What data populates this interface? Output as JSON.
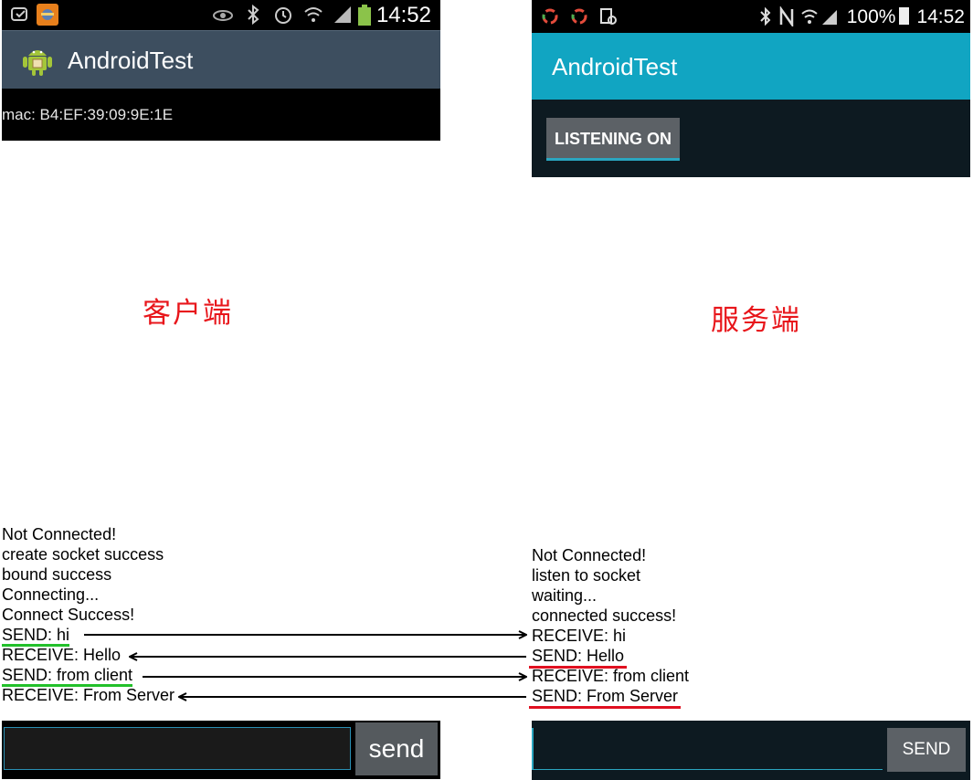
{
  "client": {
    "status_bar": {
      "time": "14:52",
      "icons": [
        "message-icon",
        "notification-app-icon",
        "eye-icon",
        "bluetooth-icon",
        "alarm-icon",
        "wifi-icon",
        "signal-icon",
        "battery-icon"
      ]
    },
    "app_title": "AndroidTest",
    "mac_text": "mac: B4:EF:39:09:9E:1E",
    "label": "客户端",
    "log": [
      "Not Connected!",
      "create socket success",
      "bound success",
      "Connecting...",
      "Connect Success!",
      "SEND: hi",
      "RECEIVE: Hello",
      "SEND: from client",
      "RECEIVE: From Server"
    ],
    "input_value": "",
    "send_label": "send"
  },
  "server": {
    "status_bar": {
      "time": "14:52",
      "battery": "100%",
      "icons": [
        "sync-icon",
        "sync-icon",
        "screenshot-icon",
        "bluetooth-icon",
        "nfc-icon",
        "wifi-icon",
        "signal-icon",
        "battery-icon"
      ]
    },
    "app_title": "AndroidTest",
    "listen_button": "LISTENING ON",
    "label": "服务端",
    "log": [
      "Not Connected!",
      "listen to socket",
      "waiting...",
      "connected success!",
      "RECEIVE: hi",
      "SEND: Hello",
      "RECEIVE: from client",
      "SEND: From Server"
    ],
    "input_value": "",
    "send_label": "SEND"
  },
  "colors": {
    "client_actionbar": "#3d4e5f",
    "server_actionbar": "#11a5c2",
    "label_red": "#e8161b",
    "underline_green": "#22c02a",
    "underline_red": "#e01020"
  }
}
